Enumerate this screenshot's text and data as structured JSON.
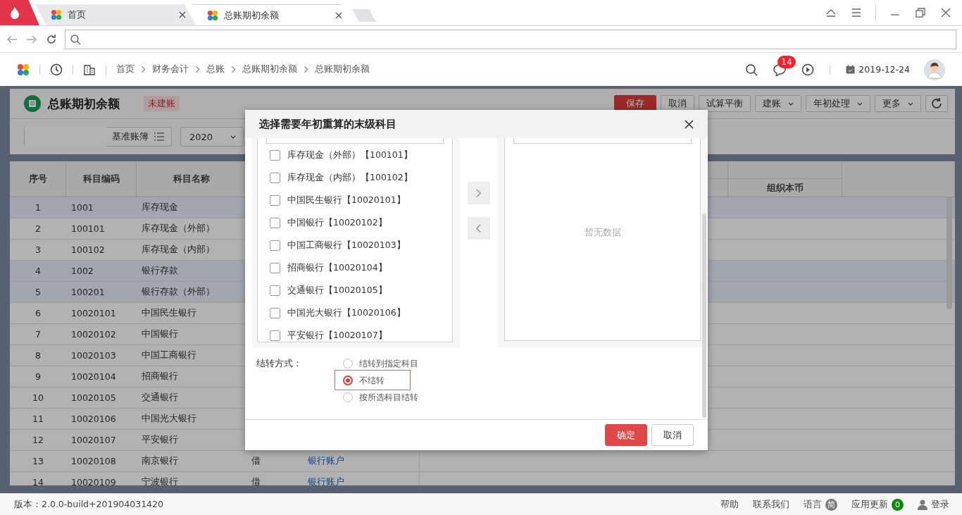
{
  "browser": {
    "tabs": [
      {
        "label": "首页",
        "selected": false
      },
      {
        "label": "总账期初余额",
        "selected": true
      }
    ]
  },
  "breadcrumb": [
    "首页",
    "财务会计",
    "总账",
    "总账期初余额",
    "总账期初余额"
  ],
  "header": {
    "message_count": "14",
    "date": "2019-12-24"
  },
  "page": {
    "title": "总账期初余额",
    "status": "未建账",
    "toolbar": [
      {
        "label": "保存",
        "kind": "primary"
      },
      {
        "label": "取消",
        "kind": "plain"
      },
      {
        "label": "试算平衡",
        "kind": "plain"
      },
      {
        "label": "建账",
        "kind": "dropdown"
      },
      {
        "label": "年初处理",
        "kind": "dropdown"
      },
      {
        "label": "更多",
        "kind": "dropdown"
      },
      {
        "kind": "refresh"
      }
    ],
    "filters": {
      "book": "基准账簿",
      "year": "2020"
    }
  },
  "table": {
    "columns": [
      "序号",
      "科目编码",
      "科目名称"
    ],
    "sub_column": "组织本币",
    "rows": [
      {
        "cells": [
          "1",
          "1001",
          "库存现金"
        ],
        "highlighted": true
      },
      {
        "cells": [
          "2",
          "100101",
          "库存现金（外部）"
        ],
        "highlighted": false
      },
      {
        "cells": [
          "3",
          "100102",
          "库存现金（内部）"
        ],
        "highlighted": false
      },
      {
        "cells": [
          "4",
          "1002",
          "银行存款"
        ],
        "highlighted": true
      },
      {
        "cells": [
          "5",
          "100201",
          "银行存款（外部）"
        ],
        "highlighted": true
      },
      {
        "cells": [
          "6",
          "10020101",
          "中国民生银行"
        ],
        "highlighted": false
      },
      {
        "cells": [
          "7",
          "10020102",
          "中国银行"
        ],
        "highlighted": false
      },
      {
        "cells": [
          "8",
          "10020103",
          "中国工商银行"
        ],
        "highlighted": false
      },
      {
        "cells": [
          "9",
          "10020104",
          "招商银行"
        ],
        "highlighted": false
      },
      {
        "cells": [
          "10",
          "10020105",
          "交通银行"
        ],
        "highlighted": false
      },
      {
        "cells": [
          "11",
          "10020106",
          "中国光大银行"
        ],
        "highlighted": false
      },
      {
        "cells": [
          "12",
          "10020107",
          "平安银行"
        ],
        "highlighted": false
      },
      {
        "cells": [
          "13",
          "10020108",
          "南京银行",
          "借",
          "银行账户"
        ],
        "highlighted": false
      },
      {
        "cells": [
          "14",
          "10020109",
          "宁波银行",
          "借",
          "银行账户"
        ],
        "highlighted": false
      }
    ]
  },
  "dialog": {
    "title": "选择需要年初重算的末级科目",
    "items": [
      {
        "label": "库存现金（外部）【100101】",
        "checked": false
      },
      {
        "label": "库存现金（内部）【100102】",
        "checked": false
      },
      {
        "label": "中国民生银行【10020101】",
        "checked": false
      },
      {
        "label": "中国银行【10020102】",
        "checked": false
      },
      {
        "label": "中国工商银行【10020103】",
        "checked": false
      },
      {
        "label": "招商银行【10020104】",
        "checked": false
      },
      {
        "label": "交通银行【10020105】",
        "checked": false
      },
      {
        "label": "中国光大银行【10020106】",
        "checked": false
      },
      {
        "label": "平安银行【10020107】",
        "checked": false
      }
    ],
    "empty_text": "暂无数据",
    "carry_label": "结转方式：",
    "carry_options": [
      {
        "label": "结转到指定科目",
        "selected": false
      },
      {
        "label": "不结转",
        "selected": true
      },
      {
        "label": "按所选科目结转",
        "selected": false
      }
    ],
    "buttons": [
      {
        "label": "确定",
        "kind": "primary"
      },
      {
        "label": "取消",
        "kind": "plain"
      }
    ]
  },
  "footer": {
    "version": "版本：2.0.0-build+201904031420",
    "links": [
      {
        "label": "帮助"
      },
      {
        "label": "联系我们"
      },
      {
        "label": "语言",
        "badge": "简",
        "color": "#7a7a7a"
      },
      {
        "label": "应用更新",
        "badge": "0",
        "color": "#0a8a0a"
      },
      {
        "label": "登录",
        "kind": "user"
      }
    ]
  }
}
